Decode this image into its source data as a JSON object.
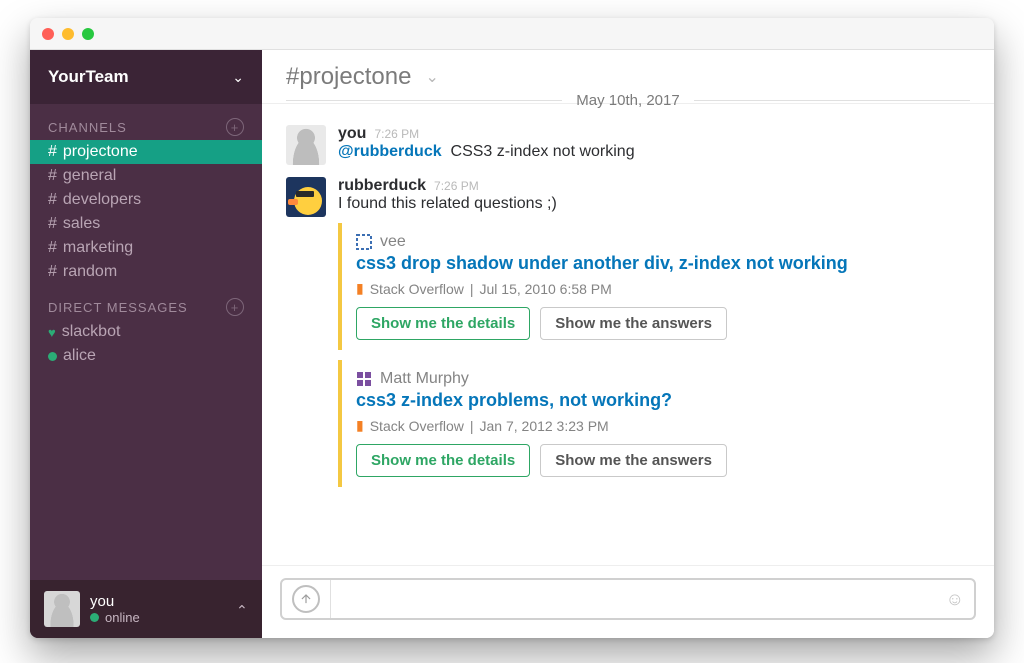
{
  "team": {
    "name": "YourTeam"
  },
  "sidebar": {
    "channels_label": "CHANNELS",
    "dms_label": "DIRECT MESSAGES",
    "channels": [
      {
        "name": "projectone",
        "active": true
      },
      {
        "name": "general"
      },
      {
        "name": "developers"
      },
      {
        "name": "sales"
      },
      {
        "name": "marketing"
      },
      {
        "name": "random"
      }
    ],
    "dms": [
      {
        "name": "slackbot",
        "heart": true
      },
      {
        "name": "alice"
      }
    ]
  },
  "footer": {
    "name": "you",
    "status": "online"
  },
  "header": {
    "channel": "#projectone"
  },
  "divider": {
    "date": "May 10th, 2017"
  },
  "messages": [
    {
      "author": "you",
      "time": "7:26 PM",
      "mention": "@rubberduck",
      "text": "CSS3 z-index not working"
    },
    {
      "author": "rubberduck",
      "time": "7:26 PM",
      "text": "I found this related questions ;)",
      "attachments": [
        {
          "author": "vee",
          "title": "css3 drop shadow under another div, z-index not working",
          "source": "Stack Overflow",
          "meta": "Jul 15, 2010 6:58 PM",
          "btn_details": "Show me the details",
          "btn_answers": "Show me the answers"
        },
        {
          "author": "Matt Murphy",
          "title": "css3 z-index problems, not working?",
          "source": "Stack Overflow",
          "meta": "Jan 7, 2012 3:23 PM",
          "btn_details": "Show me the details",
          "btn_answers": "Show me the answers"
        }
      ]
    }
  ],
  "composer": {
    "placeholder": ""
  }
}
